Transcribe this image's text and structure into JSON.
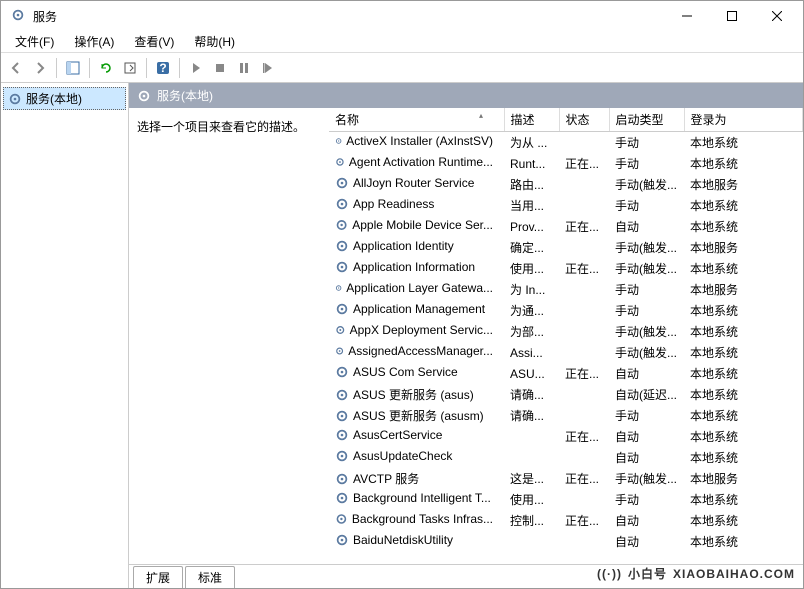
{
  "window": {
    "title": "服务"
  },
  "menus": [
    "文件(F)",
    "操作(A)",
    "查看(V)",
    "帮助(H)"
  ],
  "tree": {
    "root": "服务(本地)"
  },
  "panel": {
    "header": "服务(本地)",
    "prompt": "选择一个项目来查看它的描述。"
  },
  "columns": {
    "name": "名称",
    "desc": "描述",
    "status": "状态",
    "start": "启动类型",
    "logon": "登录为"
  },
  "tabs": {
    "extended": "扩展",
    "standard": "标准"
  },
  "services": [
    {
      "name": "ActiveX Installer (AxInstSV)",
      "desc": "为从 ...",
      "status": "",
      "start": "手动",
      "logon": "本地系统"
    },
    {
      "name": "Agent Activation Runtime...",
      "desc": "Runt...",
      "status": "正在...",
      "start": "手动",
      "logon": "本地系统"
    },
    {
      "name": "AllJoyn Router Service",
      "desc": "路由...",
      "status": "",
      "start": "手动(触发...",
      "logon": "本地服务"
    },
    {
      "name": "App Readiness",
      "desc": "当用...",
      "status": "",
      "start": "手动",
      "logon": "本地系统"
    },
    {
      "name": "Apple Mobile Device Ser...",
      "desc": "Prov...",
      "status": "正在...",
      "start": "自动",
      "logon": "本地系统"
    },
    {
      "name": "Application Identity",
      "desc": "确定...",
      "status": "",
      "start": "手动(触发...",
      "logon": "本地服务"
    },
    {
      "name": "Application Information",
      "desc": "使用...",
      "status": "正在...",
      "start": "手动(触发...",
      "logon": "本地系统"
    },
    {
      "name": "Application Layer Gatewa...",
      "desc": "为 In...",
      "status": "",
      "start": "手动",
      "logon": "本地服务"
    },
    {
      "name": "Application Management",
      "desc": "为通...",
      "status": "",
      "start": "手动",
      "logon": "本地系统"
    },
    {
      "name": "AppX Deployment Servic...",
      "desc": "为部...",
      "status": "",
      "start": "手动(触发...",
      "logon": "本地系统"
    },
    {
      "name": "AssignedAccessManager...",
      "desc": "Assi...",
      "status": "",
      "start": "手动(触发...",
      "logon": "本地系统"
    },
    {
      "name": "ASUS Com Service",
      "desc": "ASU...",
      "status": "正在...",
      "start": "自动",
      "logon": "本地系统"
    },
    {
      "name": "ASUS 更新服务 (asus)",
      "desc": "请确...",
      "status": "",
      "start": "自动(延迟...",
      "logon": "本地系统"
    },
    {
      "name": "ASUS 更新服务 (asusm)",
      "desc": "请确...",
      "status": "",
      "start": "手动",
      "logon": "本地系统"
    },
    {
      "name": "AsusCertService",
      "desc": "",
      "status": "正在...",
      "start": "自动",
      "logon": "本地系统"
    },
    {
      "name": "AsusUpdateCheck",
      "desc": "",
      "status": "",
      "start": "自动",
      "logon": "本地系统"
    },
    {
      "name": "AVCTP 服务",
      "desc": "这是...",
      "status": "正在...",
      "start": "手动(触发...",
      "logon": "本地服务"
    },
    {
      "name": "Background Intelligent T...",
      "desc": "使用...",
      "status": "",
      "start": "手动",
      "logon": "本地系统"
    },
    {
      "name": "Background Tasks Infras...",
      "desc": "控制...",
      "status": "正在...",
      "start": "自动",
      "logon": "本地系统"
    },
    {
      "name": "BaiduNetdiskUtility",
      "desc": "",
      "status": "",
      "start": "自动",
      "logon": "本地系统"
    }
  ],
  "watermark": {
    "cn": "小白号",
    "en": "XIAOBAIHAO.COM"
  }
}
